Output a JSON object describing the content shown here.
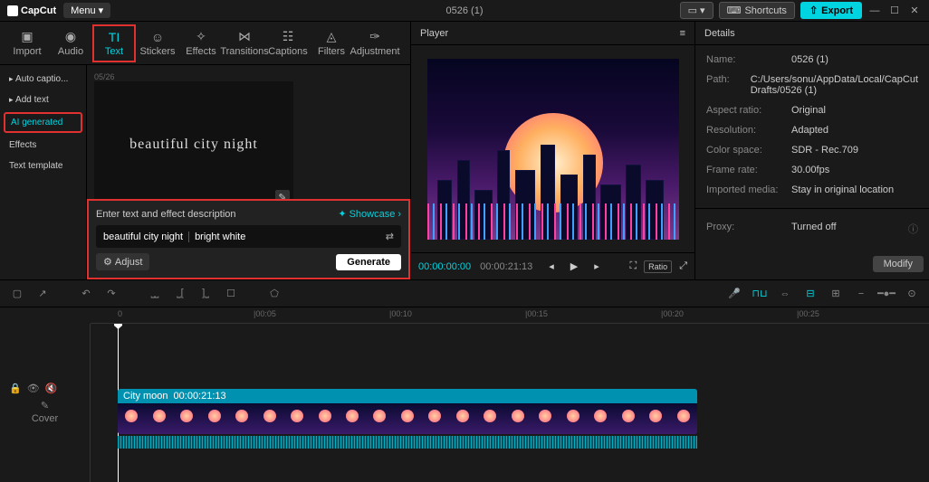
{
  "app": {
    "name": "CapCut",
    "menu": "Menu"
  },
  "project_title": "0526 (1)",
  "topbar": {
    "shortcuts": "Shortcuts",
    "export": "Export"
  },
  "tabs": {
    "import": "Import",
    "audio": "Audio",
    "text": "Text",
    "stickers": "Stickers",
    "effects": "Effects",
    "transitions": "Transitions",
    "captions": "Captions",
    "filters": "Filters",
    "adjustment": "Adjustment"
  },
  "side": {
    "auto_captions": "Auto captio...",
    "add_text": "Add text",
    "ai_generated": "AI generated",
    "effects": "Effects",
    "text_template": "Text template"
  },
  "preview": {
    "timestamp": "05/26",
    "sample_text": "beautiful city night"
  },
  "prompt": {
    "title": "Enter text and effect description",
    "showcase": "Showcase",
    "text1": "beautiful city night",
    "text2": "bright white",
    "adjust": "Adjust",
    "generate": "Generate"
  },
  "player": {
    "title": "Player",
    "current": "00:00:00:00",
    "duration": "00:00:21:13",
    "ratio": "Ratio"
  },
  "details": {
    "title": "Details",
    "name_l": "Name:",
    "name_v": "0526 (1)",
    "path_l": "Path:",
    "path_v": "C:/Users/sonu/AppData/Local/CapCut Drafts/0526 (1)",
    "aspect_l": "Aspect ratio:",
    "aspect_v": "Original",
    "res_l": "Resolution:",
    "res_v": "Adapted",
    "cs_l": "Color space:",
    "cs_v": "SDR - Rec.709",
    "fr_l": "Frame rate:",
    "fr_v": "30.00fps",
    "im_l": "Imported media:",
    "im_v": "Stay in original location",
    "proxy_l": "Proxy:",
    "proxy_v": "Turned off",
    "modify": "Modify"
  },
  "timeline": {
    "ticks": [
      "0",
      "|00:05",
      "|00:10",
      "|00:15",
      "|00:20",
      "|00:25"
    ],
    "clip_name": "City moon",
    "clip_dur": "00:00:21:13",
    "cover": "Cover"
  }
}
